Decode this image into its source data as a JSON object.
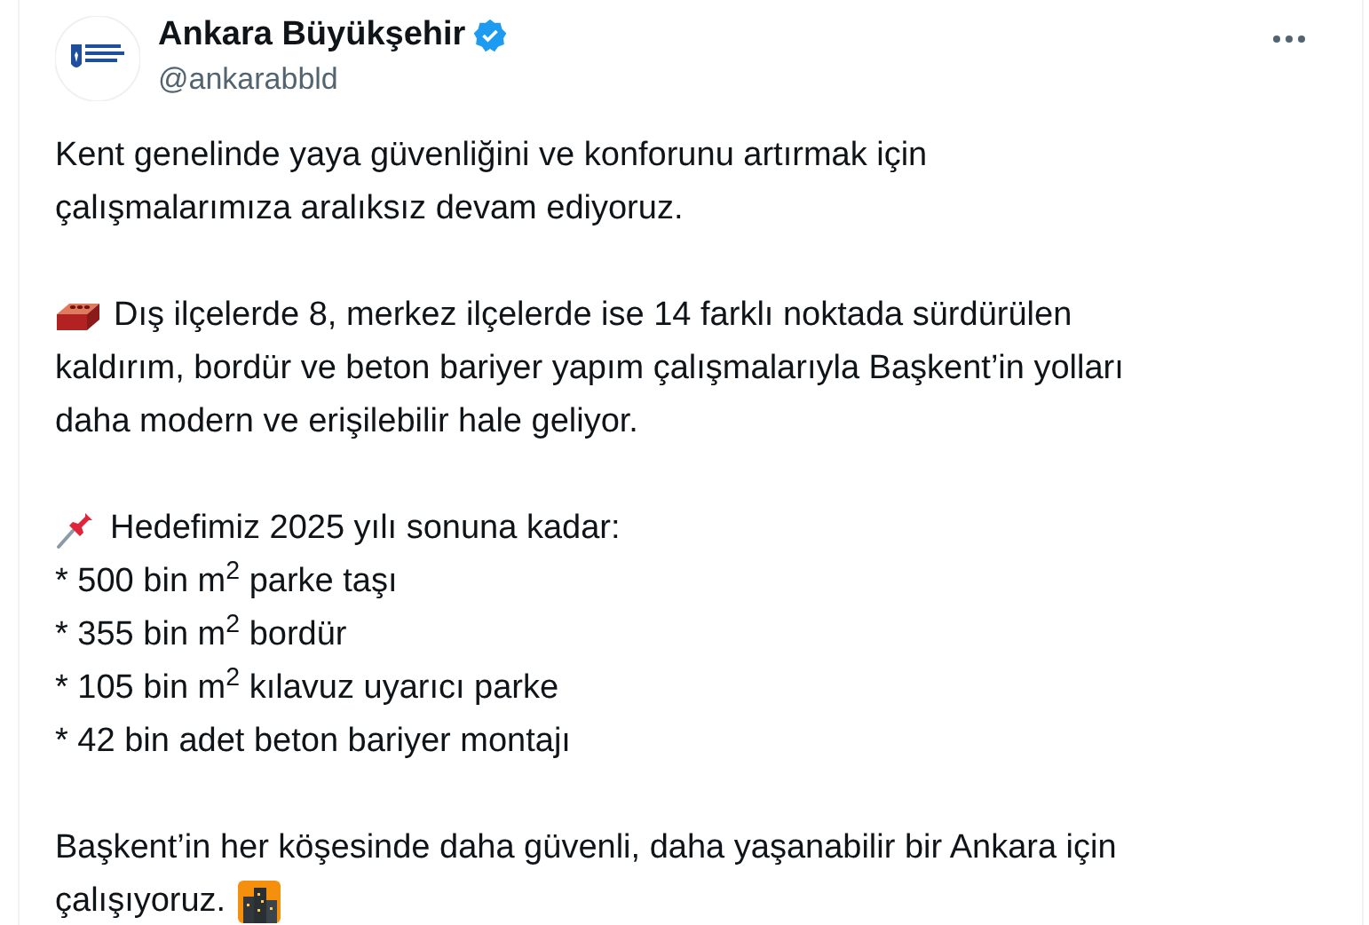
{
  "author": {
    "name": "Ankara Büyükşehir",
    "verified": true,
    "handle": "@ankarabbld"
  },
  "paragraphs": [
    {
      "kind": "plain",
      "lines": [
        "Kent genelinde yaya güvenliğini ve konforunu artırmak için",
        "çalışmalarımıza aralıksız devam ediyoruz."
      ]
    },
    {
      "kind": "brick",
      "lines": [
        "Dış ilçelerde 8, merkez ilçelerde ise 14 farklı noktada sürdürülen",
        "kaldırım, bordür ve beton bariyer yapım çalışmalarıyla Başkent’in yolları",
        "daha modern ve erişilebilir hale geliyor."
      ]
    },
    {
      "kind": "pin",
      "lines": [
        "Hedefimiz 2025 yılı sonuna kadar:",
        "* 500 bin m$^{2}$ parke taşı",
        "* 355 bin m$^{2}$ bordür",
        "* 105 bin m$^{2}$ kılavuz uyarıcı parke",
        "* 42 bin adet beton bariyer montajı"
      ]
    },
    {
      "kind": "city",
      "lines": [
        "Başkent’in her köşesinde daha güvenli, daha yaşanabilir bir Ankara için",
        "çalışıyoruz."
      ]
    }
  ]
}
